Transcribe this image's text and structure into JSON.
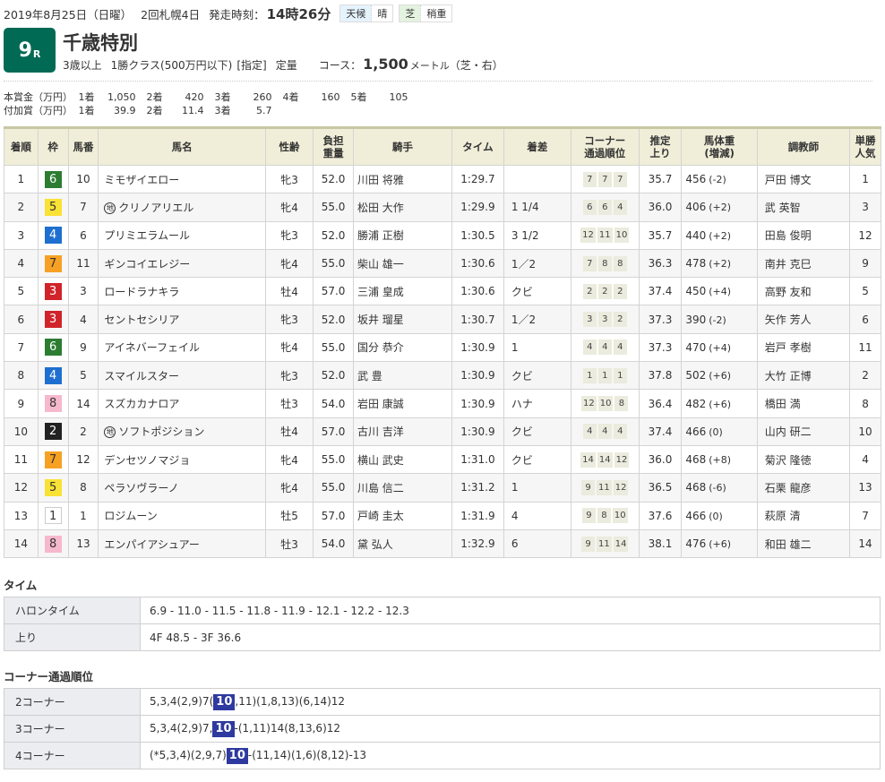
{
  "header": {
    "date": "2019年8月25日（日曜）",
    "meeting": "2回札幌4日",
    "post_time_label": "発走時刻：",
    "post_time": "14時26分",
    "weather_label": "天候",
    "weather": "晴",
    "surface_label": "芝",
    "going": "稍重"
  },
  "race": {
    "number": "9",
    "number_suffix": "R",
    "name": "千歳特別",
    "age": "3歳以上",
    "class": "1勝クラス(500万円以下)",
    "designation": "[指定]",
    "weight_rule": "定量",
    "course_label": "コース：",
    "distance": "1,500",
    "distance_unit": "メートル",
    "course_detail": "（芝・右）",
    "colors": {
      "race_badge": "#006a55",
      "highlight": "#2e3a9f"
    }
  },
  "prize": {
    "main_label": "本賞金（万円）",
    "main": [
      {
        "pos": "1着",
        "value": "1,050"
      },
      {
        "pos": "2着",
        "value": "420"
      },
      {
        "pos": "3着",
        "value": "260"
      },
      {
        "pos": "4着",
        "value": "160"
      },
      {
        "pos": "5着",
        "value": "105"
      }
    ],
    "extra_label": "付加賞（万円）",
    "extra": [
      {
        "pos": "1着",
        "value": "39.9"
      },
      {
        "pos": "2着",
        "value": "11.4"
      },
      {
        "pos": "3着",
        "value": "5.7"
      }
    ]
  },
  "results": {
    "columns": [
      "着順",
      "枠",
      "馬番",
      "馬名",
      "性齢",
      "負担\n重量",
      "騎手",
      "タイム",
      "着差",
      "コーナー\n通過順位",
      "推定\n上り",
      "馬体重\n(増減)",
      "調教師",
      "単勝\n人気"
    ],
    "local_mark": "地",
    "rows": [
      {
        "rank": "1",
        "waku": "6",
        "num": "10",
        "name": "ミモザイエロー",
        "local": false,
        "sexage": "牝3",
        "weight": "52.0",
        "jockey": "川田 将雅",
        "time": "1:29.7",
        "margin": "",
        "corners": [
          "7",
          "7",
          "7"
        ],
        "last3f": "35.7",
        "body": "456",
        "body_chg": "(-2)",
        "trainer": "戸田 博文",
        "pop": "1"
      },
      {
        "rank": "2",
        "waku": "5",
        "num": "7",
        "name": "クリノアリエル",
        "local": true,
        "sexage": "牝4",
        "weight": "55.0",
        "jockey": "松田 大作",
        "time": "1:29.9",
        "margin": "1 1/4",
        "corners": [
          "6",
          "6",
          "4"
        ],
        "last3f": "36.0",
        "body": "406",
        "body_chg": "(+2)",
        "trainer": "武 英智",
        "pop": "3"
      },
      {
        "rank": "3",
        "waku": "4",
        "num": "6",
        "name": "プリミエラムール",
        "local": false,
        "sexage": "牝3",
        "weight": "52.0",
        "jockey": "勝浦 正樹",
        "time": "1:30.5",
        "margin": "3 1/2",
        "corners": [
          "12",
          "11",
          "10"
        ],
        "last3f": "35.7",
        "body": "440",
        "body_chg": "(+2)",
        "trainer": "田島 俊明",
        "pop": "12"
      },
      {
        "rank": "4",
        "waku": "7",
        "num": "11",
        "name": "ギンコイエレジー",
        "local": false,
        "sexage": "牝4",
        "weight": "55.0",
        "jockey": "柴山 雄一",
        "time": "1:30.6",
        "margin": "1／2",
        "corners": [
          "7",
          "8",
          "8"
        ],
        "last3f": "36.3",
        "body": "478",
        "body_chg": "(+2)",
        "trainer": "南井 克巳",
        "pop": "9"
      },
      {
        "rank": "5",
        "waku": "3",
        "num": "3",
        "name": "ロードラナキラ",
        "local": false,
        "sexage": "牡4",
        "weight": "57.0",
        "jockey": "三浦 皇成",
        "time": "1:30.6",
        "margin": "クビ",
        "corners": [
          "2",
          "2",
          "2"
        ],
        "last3f": "37.4",
        "body": "450",
        "body_chg": "(+4)",
        "trainer": "高野 友和",
        "pop": "5"
      },
      {
        "rank": "6",
        "waku": "3",
        "num": "4",
        "name": "セントセシリア",
        "local": false,
        "sexage": "牝3",
        "weight": "52.0",
        "jockey": "坂井 瑠星",
        "time": "1:30.7",
        "margin": "1／2",
        "corners": [
          "3",
          "3",
          "2"
        ],
        "last3f": "37.3",
        "body": "390",
        "body_chg": "(-2)",
        "trainer": "矢作 芳人",
        "pop": "6"
      },
      {
        "rank": "7",
        "waku": "6",
        "num": "9",
        "name": "アイネバーフェイル",
        "local": false,
        "sexage": "牝4",
        "weight": "55.0",
        "jockey": "国分 恭介",
        "time": "1:30.9",
        "margin": "1",
        "corners": [
          "4",
          "4",
          "4"
        ],
        "last3f": "37.3",
        "body": "470",
        "body_chg": "(+4)",
        "trainer": "岩戸 孝樹",
        "pop": "11"
      },
      {
        "rank": "8",
        "waku": "4",
        "num": "5",
        "name": "スマイルスター",
        "local": false,
        "sexage": "牝3",
        "weight": "52.0",
        "jockey": "武 豊",
        "time": "1:30.9",
        "margin": "クビ",
        "corners": [
          "1",
          "1",
          "1"
        ],
        "last3f": "37.8",
        "body": "502",
        "body_chg": "(+6)",
        "trainer": "大竹 正博",
        "pop": "2"
      },
      {
        "rank": "9",
        "waku": "8",
        "num": "14",
        "name": "スズカカナロア",
        "local": false,
        "sexage": "牡3",
        "weight": "54.0",
        "jockey": "岩田 康誠",
        "time": "1:30.9",
        "margin": "ハナ",
        "corners": [
          "12",
          "10",
          "8"
        ],
        "last3f": "36.4",
        "body": "482",
        "body_chg": "(+6)",
        "trainer": "橋田 満",
        "pop": "8"
      },
      {
        "rank": "10",
        "waku": "2",
        "num": "2",
        "name": "ソフトポジション",
        "local": true,
        "sexage": "牡4",
        "weight": "57.0",
        "jockey": "古川 吉洋",
        "time": "1:30.9",
        "margin": "クビ",
        "corners": [
          "4",
          "4",
          "4"
        ],
        "last3f": "37.4",
        "body": "466",
        "body_chg": "(0)",
        "trainer": "山内 研二",
        "pop": "10"
      },
      {
        "rank": "11",
        "waku": "7",
        "num": "12",
        "name": "デンセツノマジョ",
        "local": false,
        "sexage": "牝4",
        "weight": "55.0",
        "jockey": "横山 武史",
        "time": "1:31.0",
        "margin": "クビ",
        "corners": [
          "14",
          "14",
          "12"
        ],
        "last3f": "36.0",
        "body": "468",
        "body_chg": "(+8)",
        "trainer": "菊沢 隆徳",
        "pop": "4"
      },
      {
        "rank": "12",
        "waku": "5",
        "num": "8",
        "name": "ペラソヴラーノ",
        "local": false,
        "sexage": "牝4",
        "weight": "55.0",
        "jockey": "川島 信二",
        "time": "1:31.2",
        "margin": "1",
        "corners": [
          "9",
          "11",
          "12"
        ],
        "last3f": "36.5",
        "body": "468",
        "body_chg": "(-6)",
        "trainer": "石栗 龍彦",
        "pop": "13"
      },
      {
        "rank": "13",
        "waku": "1",
        "num": "1",
        "name": "ロジムーン",
        "local": false,
        "sexage": "牡5",
        "weight": "57.0",
        "jockey": "戸崎 圭太",
        "time": "1:31.9",
        "margin": "4",
        "corners": [
          "9",
          "8",
          "10"
        ],
        "last3f": "37.6",
        "body": "466",
        "body_chg": "(0)",
        "trainer": "萩原 清",
        "pop": "7"
      },
      {
        "rank": "14",
        "waku": "8",
        "num": "13",
        "name": "エンパイアシュアー",
        "local": false,
        "sexage": "牡3",
        "weight": "54.0",
        "jockey": "黛 弘人",
        "time": "1:32.9",
        "margin": "6",
        "corners": [
          "9",
          "11",
          "14"
        ],
        "last3f": "38.1",
        "body": "476",
        "body_chg": "(+6)",
        "trainer": "和田 雄二",
        "pop": "14"
      }
    ],
    "waku_colors": {
      "1": {
        "bg": "#ffffff",
        "fg": "#333333",
        "border": "#cccccc"
      },
      "2": {
        "bg": "#222222",
        "fg": "#ffffff"
      },
      "3": {
        "bg": "#d0242a",
        "fg": "#ffffff"
      },
      "4": {
        "bg": "#1e6fd0",
        "fg": "#ffffff"
      },
      "5": {
        "bg": "#f9e235",
        "fg": "#333333"
      },
      "6": {
        "bg": "#2c7d32",
        "fg": "#ffffff"
      },
      "7": {
        "bg": "#f6a124",
        "fg": "#333333"
      },
      "8": {
        "bg": "#f5b8cc",
        "fg": "#333333"
      }
    }
  },
  "time_section": {
    "title": "タイム",
    "rows": [
      {
        "label": "ハロンタイム",
        "value": "6.9 - 11.0 - 11.5 - 11.8 - 11.9 - 12.1 - 12.2 - 12.3"
      },
      {
        "label": "上り",
        "value": "4F 48.5 - 3F 36.6"
      }
    ]
  },
  "corner_section": {
    "title": "コーナー通過順位",
    "highlight_horse": "10",
    "rows": [
      {
        "label": "2コーナー",
        "before": "5,3,4(2,9)7(",
        "after": ",11)(1,8,13)(6,14)12"
      },
      {
        "label": "3コーナー",
        "before": "5,3,4(2,9)7,",
        "after": "-(1,11)14(8,13,6)12"
      },
      {
        "label": "4コーナー",
        "before": "(*5,3,4)(2,9,7)",
        "after": "-(11,14)(1,6)(8,12)-13"
      }
    ]
  }
}
